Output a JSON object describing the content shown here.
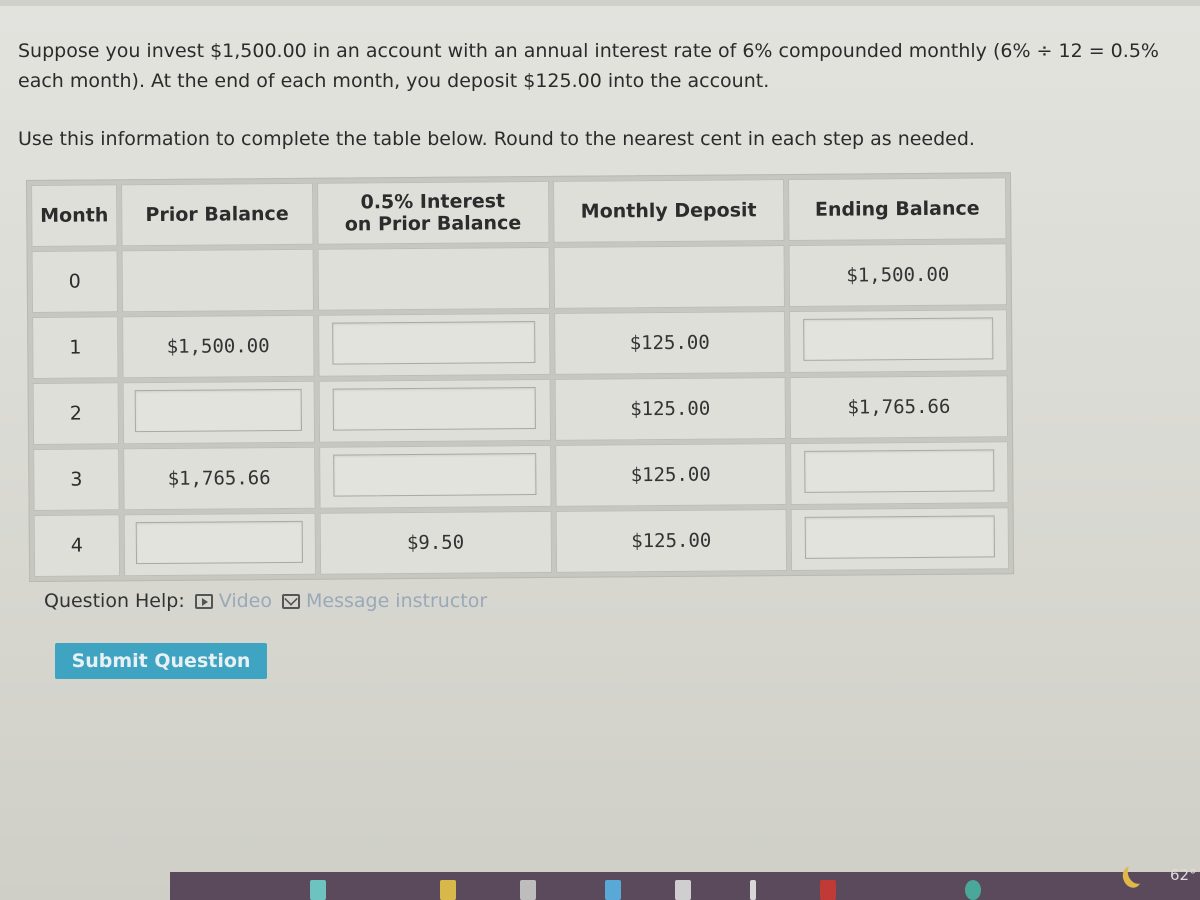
{
  "question": {
    "intro": "Suppose you invest $1,500.00 in an account with an annual interest rate of 6% compounded monthly (6% ÷ 12 = 0.5% each month). At the end of each month, you deposit $125.00 into the account.",
    "instructions": "Use this information to complete the table below. Round to the nearest cent in each step as needed."
  },
  "table": {
    "headers": {
      "month": "Month",
      "prior_balance": "Prior Balance",
      "interest_line1": "0.5% Interest",
      "interest_line2": "on Prior Balance",
      "monthly_deposit": "Monthly Deposit",
      "ending_balance": "Ending Balance"
    },
    "rows": [
      {
        "month": "0",
        "prior_balance": "",
        "interest": "",
        "deposit": "",
        "ending": "$1,500.00"
      },
      {
        "month": "1",
        "prior_balance": "$1,500.00",
        "interest": "",
        "deposit": "$125.00",
        "ending": ""
      },
      {
        "month": "2",
        "prior_balance": "",
        "interest": "",
        "deposit": "$125.00",
        "ending": "$1,765.66"
      },
      {
        "month": "3",
        "prior_balance": "$1,765.66",
        "interest": "",
        "deposit": "$125.00",
        "ending": ""
      },
      {
        "month": "4",
        "prior_balance": "",
        "interest": "$9.50",
        "deposit": "$125.00",
        "ending": ""
      }
    ]
  },
  "help": {
    "label": "Question Help:",
    "video": "Video",
    "message": "Message instructor"
  },
  "submit_label": "Submit Question",
  "taskbar": {
    "temperature": "62°"
  }
}
